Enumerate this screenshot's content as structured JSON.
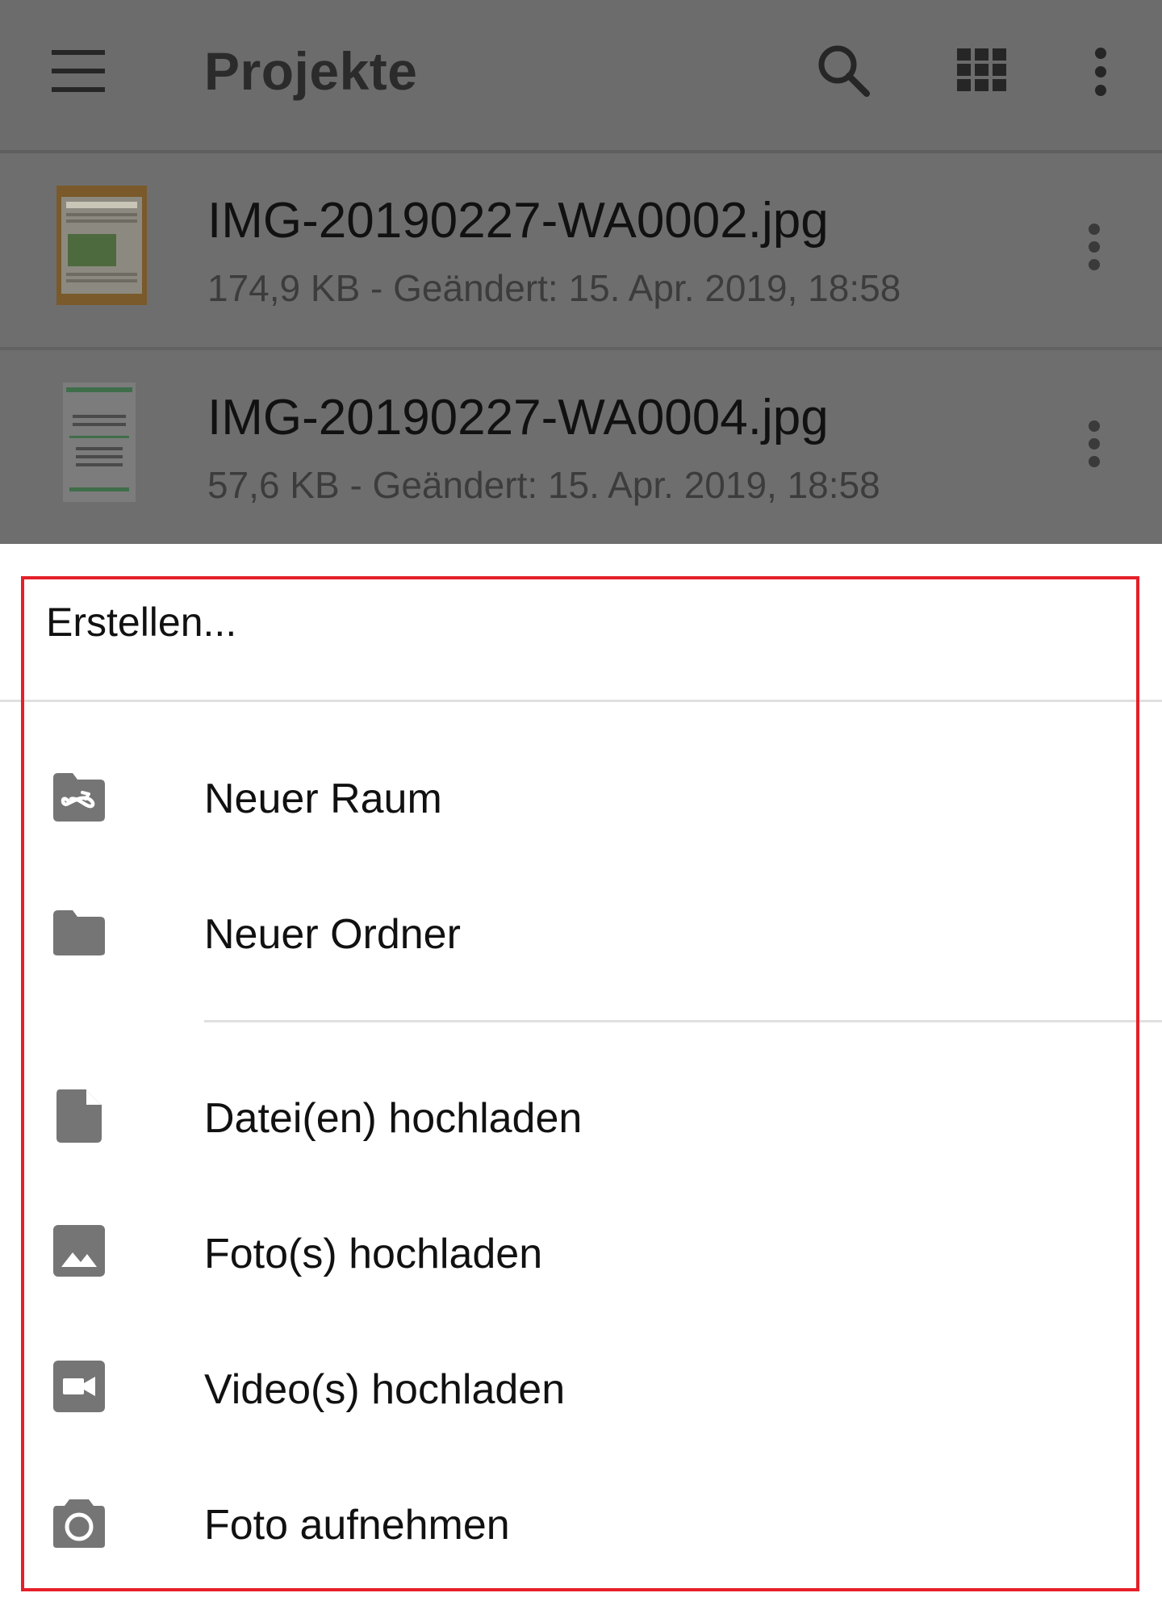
{
  "appbar": {
    "title": "Projekte",
    "icons": [
      "menu-icon",
      "search-icon",
      "grid-view-icon",
      "more-vert-icon"
    ]
  },
  "files": [
    {
      "name": "IMG-20190227-WA0002.jpg",
      "meta": "174,9 KB - Geändert: 15. Apr. 2019, 18:58"
    },
    {
      "name": "IMG-20190227-WA0004.jpg",
      "meta": "57,6 KB - Geändert: 15. Apr. 2019, 18:58"
    }
  ],
  "sheet": {
    "title": "Erstellen...",
    "items": [
      {
        "label": "Neuer Raum",
        "icon": "room-icon"
      },
      {
        "label": "Neuer Ordner",
        "icon": "folder-icon"
      },
      {
        "label": "Datei(en) hochladen",
        "icon": "file-icon"
      },
      {
        "label": "Foto(s) hochladen",
        "icon": "image-icon"
      },
      {
        "label": "Video(s) hochladen",
        "icon": "video-icon"
      },
      {
        "label": "Foto aufnehmen",
        "icon": "camera-icon"
      }
    ]
  },
  "colors": {
    "overlay": "#6c6c6c",
    "icon": "#757575",
    "highlight_border": "#e5202a"
  }
}
